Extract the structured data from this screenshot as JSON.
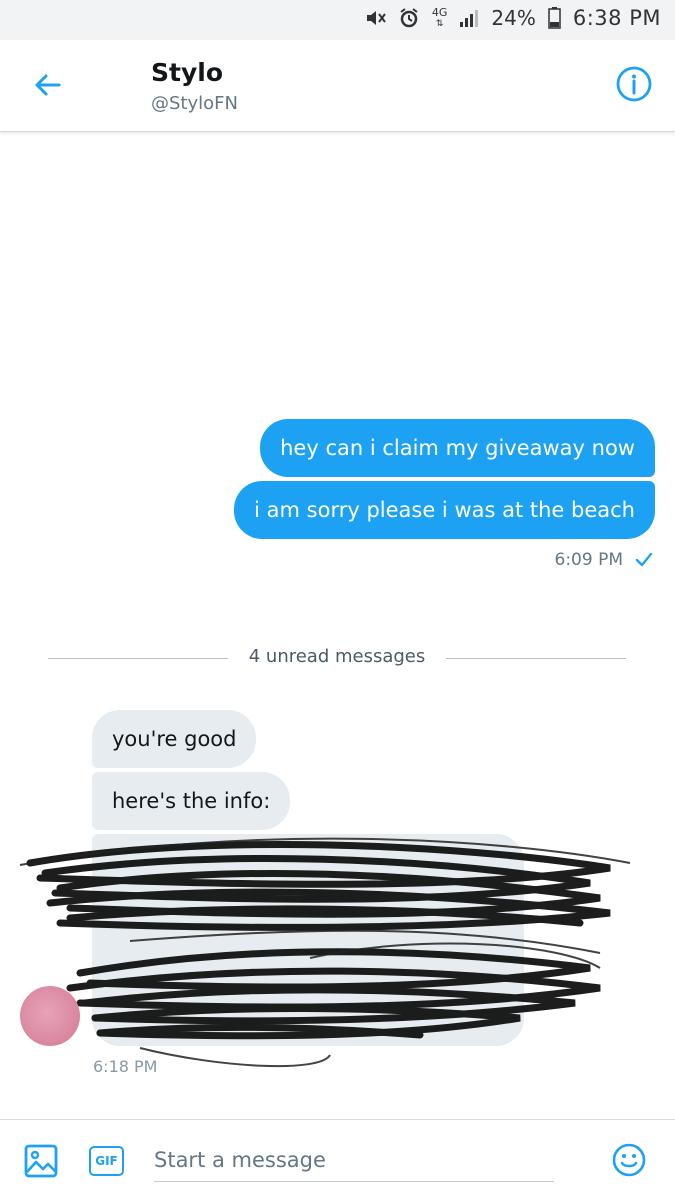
{
  "status_bar": {
    "network": "4G",
    "battery_pct": "24%",
    "time": "6:38 PM",
    "icons": [
      "mute-icon",
      "alarm-icon",
      "network-4g-icon",
      "signal-icon",
      "battery-icon"
    ]
  },
  "header": {
    "name": "Stylo",
    "handle": "@StyloFN",
    "back_icon": "arrow-left-icon",
    "info_icon": "info-icon"
  },
  "conversation": {
    "outgoing": [
      {
        "text": "hey can i claim my giveaway now"
      },
      {
        "text": "i am sorry please i was at the beach"
      }
    ],
    "outgoing_time": "6:09 PM",
    "read_icon": "check-icon",
    "unread_divider": "4 unread messages",
    "incoming": [
      {
        "text": "you're good"
      },
      {
        "text": "here's the info:"
      }
    ],
    "incoming_time": "6:18 PM"
  },
  "composer": {
    "photo_icon": "image-icon",
    "gif_label": "GIF",
    "placeholder": "Start a message",
    "emoji_icon": "emoji-icon"
  },
  "colors": {
    "accent": "#1da1f2",
    "incoming_bubble": "#e6ecf0",
    "muted_text": "#657786",
    "scribble": "#111111"
  }
}
